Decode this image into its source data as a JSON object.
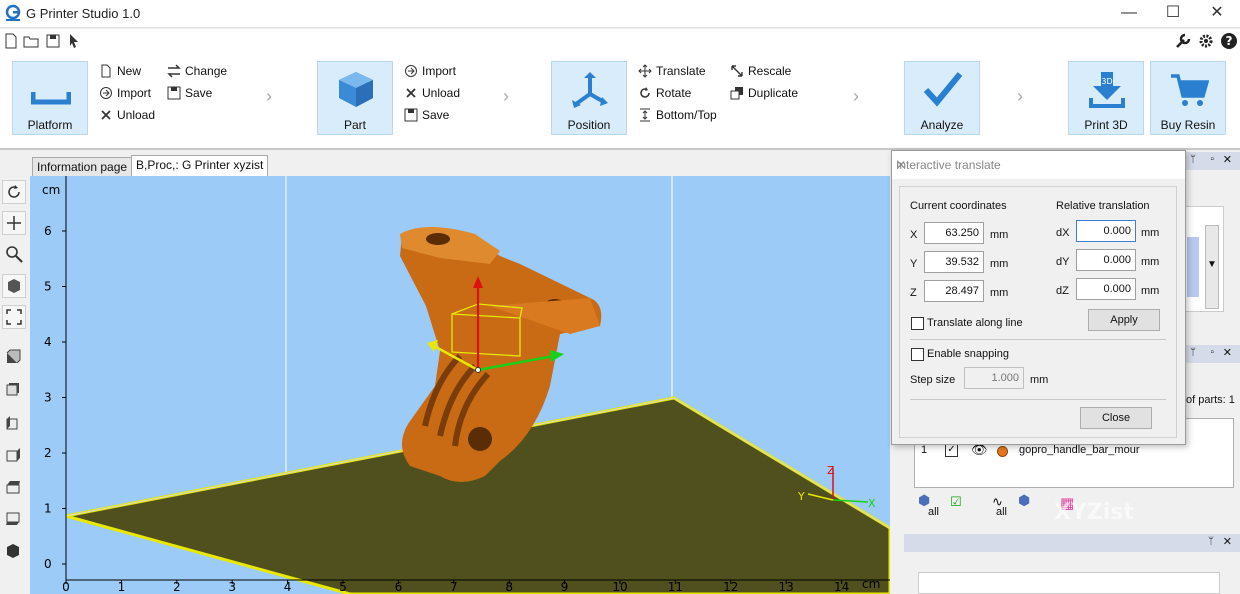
{
  "app": {
    "title": "G Printer Studio 1.0",
    "brand_color": "#1f73c7"
  },
  "window_controls": {
    "minimize": "—",
    "maximize": "☐",
    "close": "✕"
  },
  "quickbar": [
    "new-file-icon",
    "open-folder-icon",
    "save-disk-icon",
    "pointer-icon"
  ],
  "quickbar_right": [
    "wrench-icon",
    "gear-icon",
    "help-icon"
  ],
  "ribbon": {
    "platform": {
      "label": "Platform",
      "items": [
        {
          "label": "New",
          "icon": "new-file-icon"
        },
        {
          "label": "Import",
          "icon": "import-icon"
        },
        {
          "label": "Unload",
          "icon": "x-icon"
        }
      ],
      "items2": [
        {
          "label": "Change",
          "icon": "swap-icon"
        },
        {
          "label": "Save",
          "icon": "save-disk-icon"
        }
      ]
    },
    "part": {
      "label": "Part",
      "items": [
        {
          "label": "Import",
          "icon": "import-icon"
        },
        {
          "label": "Unload",
          "icon": "x-icon"
        },
        {
          "label": "Save",
          "icon": "save-disk-icon"
        }
      ]
    },
    "position": {
      "label": "Position",
      "items": [
        {
          "label": "Translate",
          "icon": "move-icon"
        },
        {
          "label": "Rotate",
          "icon": "rotate-icon"
        },
        {
          "label": "Bottom/Top",
          "icon": "bottom-top-icon"
        }
      ],
      "items2": [
        {
          "label": "Rescale",
          "icon": "rescale-icon"
        },
        {
          "label": "Duplicate",
          "icon": "duplicate-icon"
        }
      ]
    },
    "analyze": {
      "label": "Analyze"
    },
    "print3d": {
      "label": "Print 3D"
    },
    "buyresin": {
      "label": "Buy Resin"
    }
  },
  "tabs": [
    {
      "label": "Information page",
      "active": false
    },
    {
      "label": "B,Proc,: G Printer xyzist",
      "active": true
    }
  ],
  "viewport": {
    "y_unit": "cm",
    "x_unit": "cm",
    "y_ticks": [
      "6",
      "5",
      "4",
      "3",
      "2",
      "1",
      "0"
    ],
    "x_ticks": [
      "0",
      "1",
      "2",
      "3",
      "4",
      "5",
      "6",
      "7",
      "8",
      "9",
      "10",
      "11",
      "12",
      "13",
      "14"
    ],
    "axis_labels": {
      "x": "X",
      "y": "Y",
      "z": "Z"
    },
    "background": "#9ccbf7",
    "platform_color": "#50501e",
    "part_color": "#c86b14"
  },
  "dialog": {
    "title": "Interactive translate",
    "current_heading": "Current coordinates",
    "relative_heading": "Relative translation",
    "rows": [
      {
        "axis": "X",
        "value": "63.250",
        "unit": "mm",
        "rel_label": "dX",
        "rel_value": "0.000",
        "rel_unit": "mm"
      },
      {
        "axis": "Y",
        "value": "39.532",
        "unit": "mm",
        "rel_label": "dY",
        "rel_value": "0.000",
        "rel_unit": "mm"
      },
      {
        "axis": "Z",
        "value": "28.497",
        "unit": "mm",
        "rel_label": "dZ",
        "rel_value": "0.000",
        "rel_unit": "mm"
      }
    ],
    "translate_along_line": "Translate along line",
    "apply": "Apply",
    "enable_snapping": "Enable snapping",
    "step_label": "Step size",
    "step_value": "1.000",
    "step_unit": "mm",
    "close": "Close"
  },
  "parts_panel": {
    "count_text": "of parts: 1",
    "rows": [
      {
        "index": "1",
        "name": "gopro_handle_bar_mour"
      }
    ],
    "all_label_1": "all",
    "all_label_2": "all",
    "part_dot_color": "#e6781e"
  },
  "watermark": "XYZist"
}
